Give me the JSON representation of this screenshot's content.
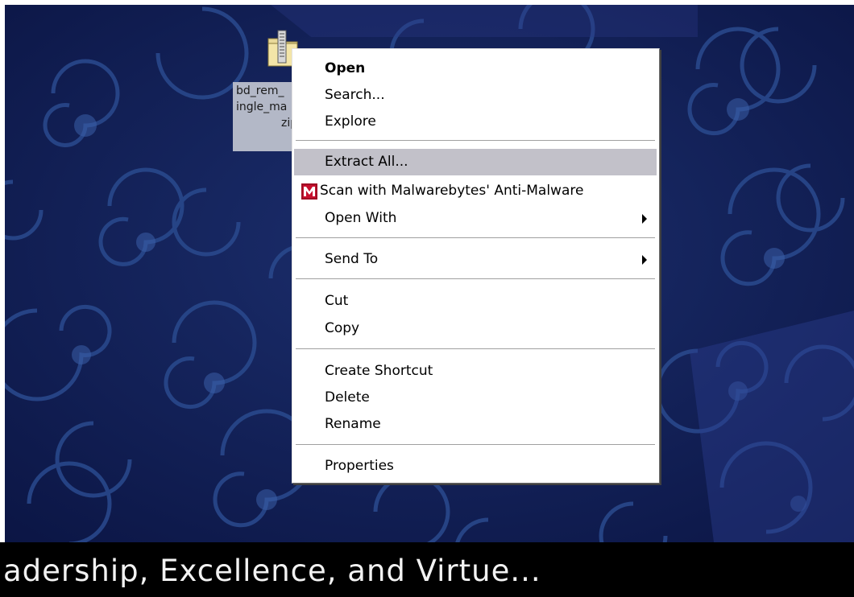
{
  "desktop": {
    "file_label_lines": [
      "bd_rem_",
      "ingle_ma",
      "zip"
    ]
  },
  "context_menu": {
    "items": [
      {
        "label": "Open",
        "bold": true
      },
      {
        "label": "Search..."
      },
      {
        "label": "Explore"
      },
      {
        "label": "Extract All...",
        "highlighted": true
      },
      {
        "label": "Scan with Malwarebytes' Anti-Malware",
        "icon": "malwarebytes-icon"
      },
      {
        "label": "Open With",
        "submenu": true
      },
      {
        "label": "Send To",
        "submenu": true
      },
      {
        "label": "Cut"
      },
      {
        "label": "Copy"
      },
      {
        "label": "Create Shortcut"
      },
      {
        "label": "Delete"
      },
      {
        "label": "Rename"
      },
      {
        "label": "Properties"
      }
    ],
    "highlight_color": "#c2c1c9"
  },
  "banner": {
    "text": "adership, Excellence, and Virtue..."
  },
  "colors": {
    "wallpaper_base": "#101c52",
    "wallpaper_swirl": "#2a4a8e",
    "malwarebytes_red": "#c8102e"
  }
}
